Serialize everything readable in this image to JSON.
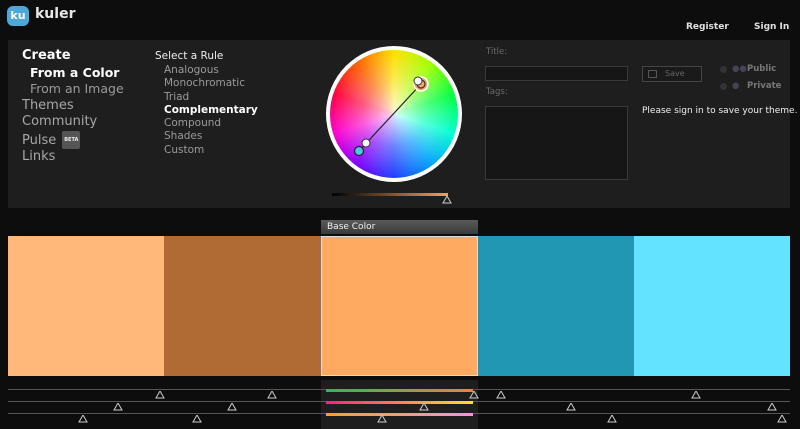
{
  "header": {
    "logo_badge": "ku",
    "logo_text": "kuler",
    "register": "Register",
    "sign_in": "Sign In"
  },
  "nav": {
    "create": "Create",
    "from_color": "From a Color",
    "from_image": "From an Image",
    "themes": "Themes",
    "community": "Community",
    "pulse": "Pulse",
    "beta": "BETA",
    "links": "Links"
  },
  "rules": {
    "title": "Select a Rule",
    "items": [
      "Analogous",
      "Monochromatic",
      "Triad",
      "Complementary",
      "Compound",
      "Shades",
      "Custom"
    ],
    "selected": "Complementary"
  },
  "form": {
    "title_label": "Title:",
    "tags_label": "Tags:",
    "save_label": "Save",
    "public_label": "Public",
    "private_label": "Private",
    "signin_message": "Please sign in to save your theme."
  },
  "base_color_label": "Base Color",
  "theme": {
    "swatches": [
      {
        "color": "#ffb87a"
      },
      {
        "color": "#b06a34"
      },
      {
        "color": "#ffaa60"
      },
      {
        "color": "#2297b3"
      },
      {
        "color": "#63e3ff"
      }
    ],
    "base_index": 2
  },
  "colors": {
    "accent_logo": "#4fa9d8",
    "background": "#0d0d0d",
    "panel": "#1e1e1e"
  }
}
